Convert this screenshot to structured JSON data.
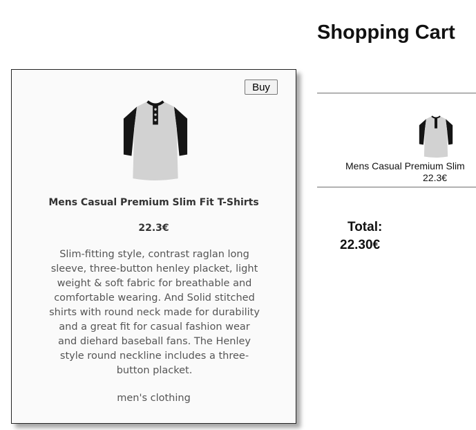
{
  "product": {
    "buy_label": "Buy",
    "title": "Mens Casual Premium Slim Fit T-Shirts",
    "price": "22.3€",
    "description": "Slim-fitting style, contrast raglan long sleeve, three-button henley placket, light weight & soft fabric for breathable and comfortable wearing. And Solid stitched shirts with round neck made for durability and a great fit for casual fashion wear and diehard baseball fans. The Henley style round neckline includes a three-button placket.",
    "category": "men's clothing"
  },
  "cart": {
    "title": "Shopping Cart",
    "items": [
      {
        "name": "Mens Casual Premium Slim",
        "price": "22.3€"
      }
    ],
    "total_label": "Total:",
    "total_value": "22.30€"
  },
  "colors": {
    "card_background": "#fafafa",
    "card_border": "#222222",
    "shirt_body": "#d2d2d2",
    "shirt_sleeves": "#151515"
  },
  "icons": {
    "product": "henley-shirt-icon",
    "cart_item": "henley-shirt-thumbnail"
  }
}
